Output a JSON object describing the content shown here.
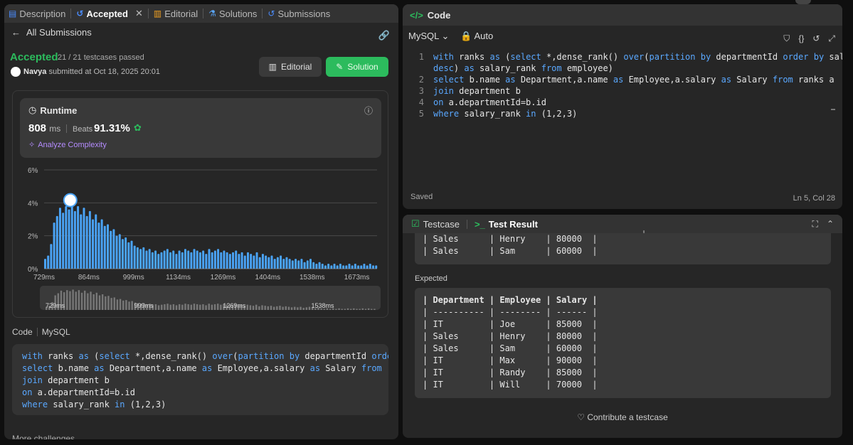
{
  "tabs": [
    {
      "label": "Description",
      "active": false
    },
    {
      "label": "Accepted",
      "active": true
    },
    {
      "label": "Editorial",
      "active": false
    },
    {
      "label": "Solutions",
      "active": false
    },
    {
      "label": "Submissions",
      "active": false
    }
  ],
  "nav": {
    "back_label": "All Submissions"
  },
  "submission": {
    "status": "Accepted",
    "testcases": "21 / 21 testcases passed",
    "user": "Navya",
    "submitted_text": "submitted at Oct 18, 2025 20:01"
  },
  "buttons": {
    "editorial": "Editorial",
    "solution": "Solution"
  },
  "runtime": {
    "title": "Runtime",
    "value": "808",
    "unit": "ms",
    "beats_label": "Beats",
    "beats_value": "91.31%",
    "analyze": "Analyze Complexity"
  },
  "chart_data": {
    "type": "bar",
    "title": "",
    "xlabel": "",
    "ylabel": "",
    "ylim": [
      0,
      6
    ],
    "y_ticks": [
      "6%",
      "4%",
      "2%",
      "0%"
    ],
    "x_ticks": [
      "729ms",
      "864ms",
      "999ms",
      "1134ms",
      "1269ms",
      "1404ms",
      "1538ms",
      "1673ms"
    ],
    "x_range": [
      729,
      1734
    ],
    "highlight_x": 808,
    "bin_width": 9,
    "values": [
      0.6,
      0.8,
      1.5,
      2.8,
      3.2,
      3.7,
      3.4,
      3.8,
      3.6,
      3.9,
      3.5,
      3.8,
      3.3,
      3.7,
      3.2,
      3.5,
      3.0,
      3.3,
      2.8,
      3.0,
      2.6,
      2.7,
      2.3,
      2.4,
      2.0,
      2.1,
      1.8,
      1.9,
      1.6,
      1.7,
      1.4,
      1.3,
      1.2,
      1.3,
      1.1,
      1.2,
      1.0,
      1.1,
      0.9,
      1.0,
      1.1,
      1.2,
      1.0,
      1.1,
      0.9,
      1.1,
      1.0,
      1.2,
      1.1,
      1.0,
      1.2,
      1.1,
      1.0,
      1.1,
      0.9,
      1.2,
      1.0,
      1.1,
      1.2,
      1.0,
      1.1,
      1.0,
      0.9,
      1.0,
      1.1,
      0.9,
      1.0,
      0.8,
      1.0,
      0.9,
      0.8,
      1.0,
      0.7,
      0.9,
      0.8,
      0.7,
      0.8,
      0.6,
      0.7,
      0.8,
      0.6,
      0.7,
      0.6,
      0.5,
      0.6,
      0.5,
      0.6,
      0.4,
      0.5,
      0.6,
      0.4,
      0.3,
      0.4,
      0.3,
      0.2,
      0.3,
      0.2,
      0.3,
      0.2,
      0.3,
      0.2,
      0.2,
      0.3,
      0.2,
      0.3,
      0.2,
      0.2,
      0.3,
      0.2,
      0.3,
      0.2,
      0.2
    ],
    "minimap_ticks": [
      "729ms",
      "999ms",
      "1269ms",
      "1538ms"
    ]
  },
  "code_section": {
    "label": "Code",
    "lang": "MySQL"
  },
  "submitted_code": [
    "with ranks as (select *,dense_rank() over(partition by departmentId order by salary",
    "select b.name as Department,a.name as Employee,a.salary as Salary from ranks a",
    "join department b",
    "on a.departmentId=b.id",
    "where salary_rank in (1,2,3)"
  ],
  "more_label": "More challenges",
  "editor": {
    "title": "Code",
    "language": "MySQL",
    "mode": "Auto",
    "saved": "Saved",
    "cursor": "Ln 5, Col 28",
    "lines": [
      {
        "n": "1",
        "text": "with ranks as (select *,dense_rank() over(partition by departmentId order by salary"
      },
      {
        "n": "",
        "text": "desc) as salary_rank from employee)"
      },
      {
        "n": "2",
        "text": "select b.name as Department,a.name as Employee,a.salary as Salary from ranks a"
      },
      {
        "n": "3",
        "text": "join department b"
      },
      {
        "n": "4",
        "text": "on a.departmentId=b.id"
      },
      {
        "n": "5",
        "text": "where salary_rank in (1,2,3)"
      }
    ]
  },
  "result": {
    "testcase_tab": "Testcase",
    "result_tab": "Test Result",
    "output_rows": [
      "| Sales      | Henry    | 80000  |",
      "| Sales      | Sam      | 60000  |"
    ],
    "expected_label": "Expected",
    "expected_rows": [
      "| Department | Employee | Salary |",
      "| ---------- | -------- | ------ |",
      "| IT         | Joe      | 85000  |",
      "| Sales      | Henry    | 80000  |",
      "| Sales      | Sam      | 60000  |",
      "| IT         | Max      | 90000  |",
      "| IT         | Randy    | 85000  |",
      "| IT         | Will     | 70000  |"
    ],
    "contribute": "Contribute a testcase"
  },
  "colors": {
    "accent_green": "#2cbb5d",
    "bar_blue": "#4aa3f5",
    "keyword_blue": "#5aa8ff",
    "panel_bg": "#262626"
  }
}
